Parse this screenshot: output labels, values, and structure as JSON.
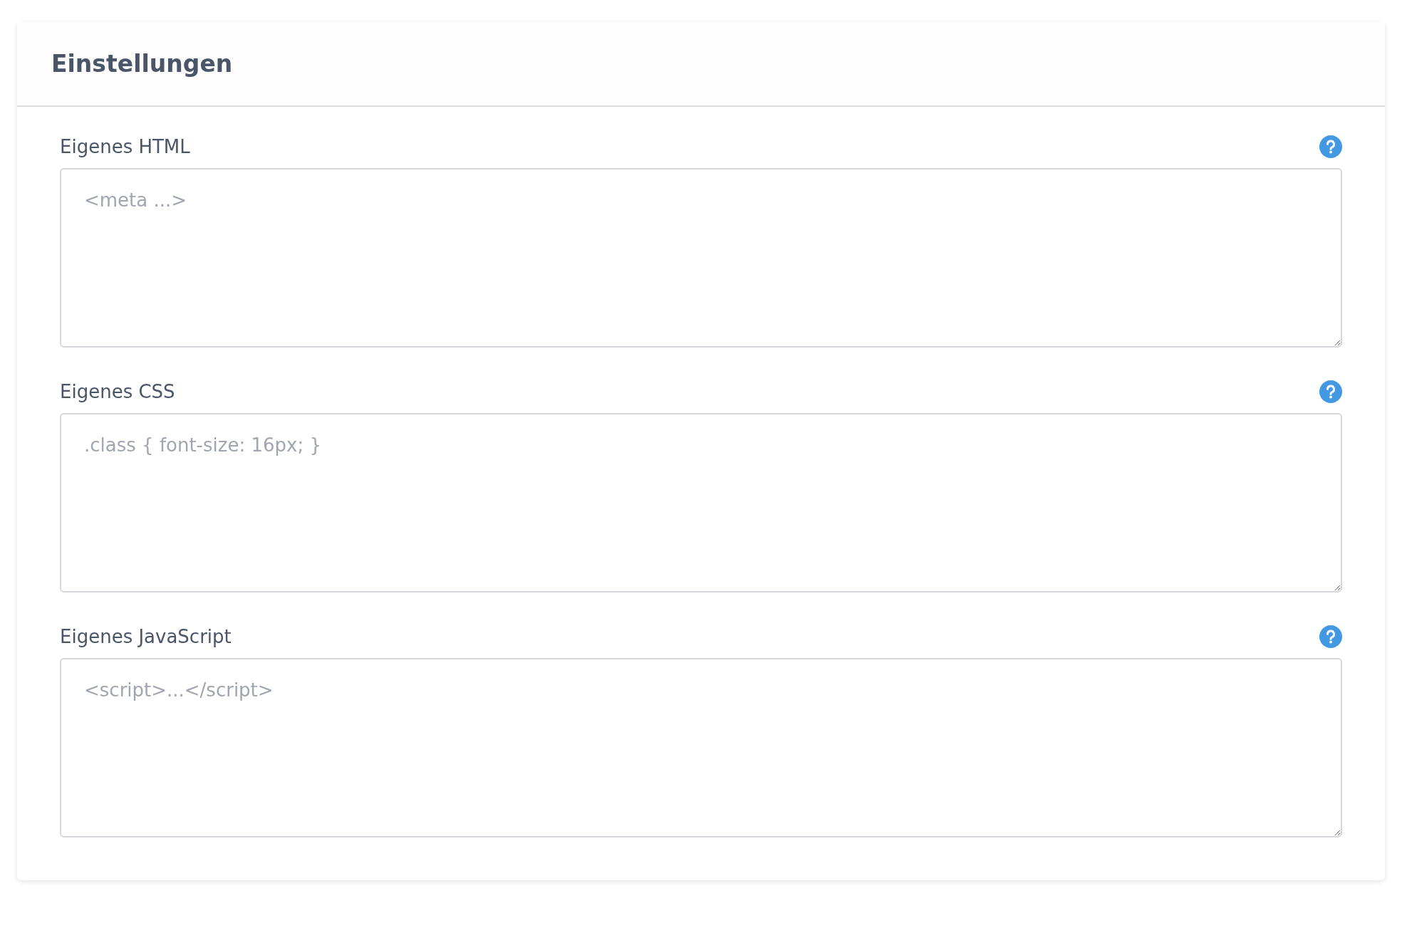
{
  "card": {
    "title": "Einstellungen"
  },
  "fields": [
    {
      "label": "Eigenes HTML",
      "placeholder": "<meta ...>"
    },
    {
      "label": "Eigenes CSS",
      "placeholder": ".class { font-size: 16px; }"
    },
    {
      "label": "Eigenes JavaScript",
      "placeholder": "<script>...</script>"
    }
  ]
}
